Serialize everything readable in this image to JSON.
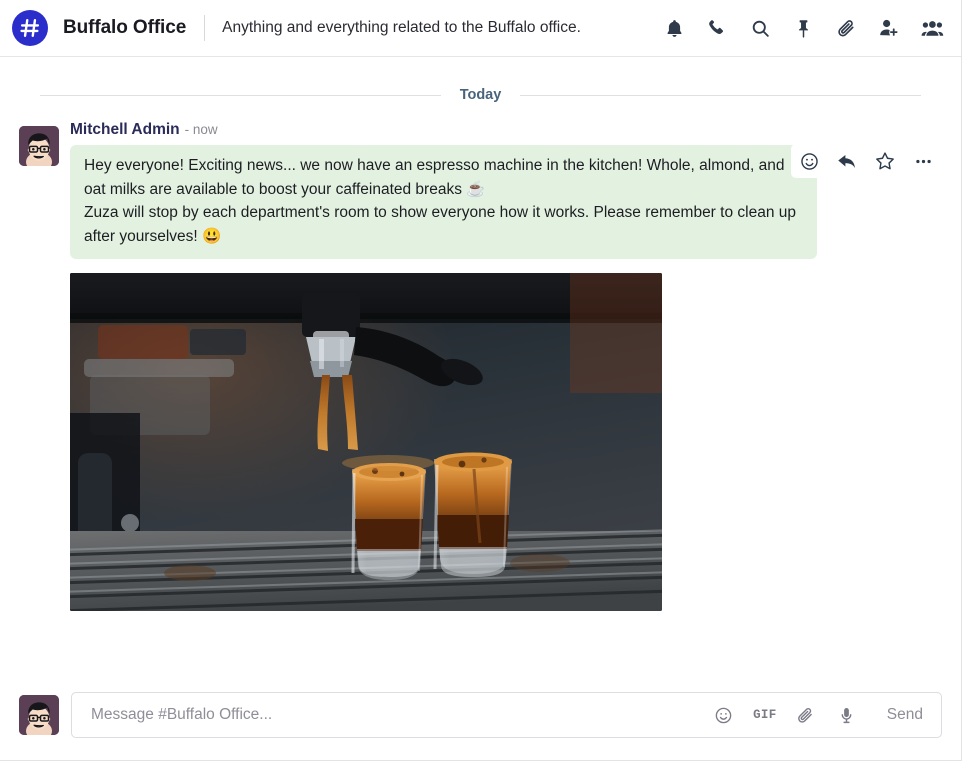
{
  "header": {
    "logo_icon": "hash-icon",
    "channel_name": "Buffalo Office",
    "channel_description": "Anything and everything related to the Buffalo office.",
    "actions": [
      {
        "name": "notifications-icon",
        "label": "Notifications"
      },
      {
        "name": "phone-icon",
        "label": "Call"
      },
      {
        "name": "search-icon",
        "label": "Search"
      },
      {
        "name": "pin-icon",
        "label": "Pinned Messages"
      },
      {
        "name": "paperclip-icon",
        "label": "Attachments"
      },
      {
        "name": "add-user-icon",
        "label": "Add Users"
      },
      {
        "name": "members-icon",
        "label": "Members"
      }
    ]
  },
  "conversation": {
    "date_divider": "Today",
    "messages": [
      {
        "author": "Mitchell Admin",
        "timestamp": "- now",
        "avatar_icon": "user-avatar",
        "text_lines": [
          "Hey everyone! Exciting news... we now have an espresso machine in the kitchen! Whole, almond, and oat milks are available to boost your caffeinated breaks ☕",
          "Zuza will stop by each department's room to show everyone how it works. Please remember to clean up after yourselves! 😃"
        ],
        "attachment": {
          "name": "espresso-machine-photo",
          "alt": "Espresso machine pouring two shots of coffee into glasses"
        },
        "actions": [
          {
            "name": "add-reaction-icon",
            "label": "Add a Reaction"
          },
          {
            "name": "reply-icon",
            "label": "Reply"
          },
          {
            "name": "star-icon",
            "label": "Mark as Todo"
          },
          {
            "name": "more-options-icon",
            "label": "Expand"
          }
        ]
      }
    ]
  },
  "composer": {
    "avatar_icon": "user-avatar",
    "placeholder": "Message #Buffalo Office...",
    "value": "",
    "tools": [
      {
        "name": "emoji-icon",
        "label": "Emoji"
      },
      {
        "name": "gif-icon",
        "label": "GIF"
      },
      {
        "name": "attach-file-icon",
        "label": "Attach Files"
      },
      {
        "name": "voice-message-icon",
        "label": "Voice Message"
      }
    ],
    "send_label": "Send"
  },
  "colors": {
    "brand": "#2b2ecb",
    "bubble": "#e3f2e0",
    "author": "#2b2b5a",
    "divider": "#49637d"
  }
}
